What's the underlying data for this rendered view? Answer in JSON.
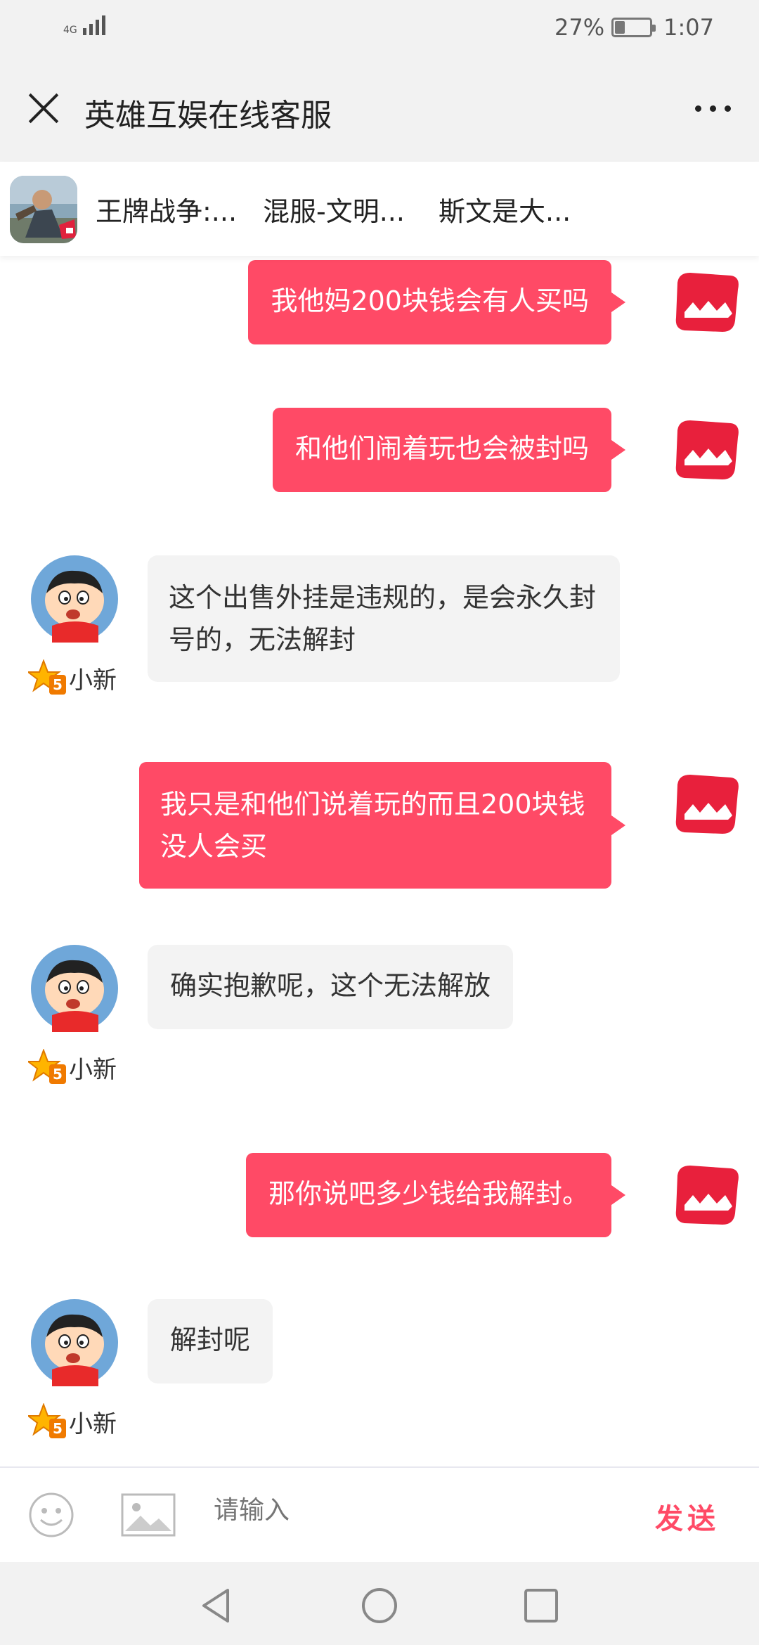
{
  "status": {
    "network": "4G",
    "battery": "27%",
    "battery_level": 0.27,
    "time": "1:07"
  },
  "header": {
    "title": "英雄互娱在线客服"
  },
  "games": [
    "王牌战争:...",
    "混服-文明...",
    "斯文是大..."
  ],
  "messages": [
    {
      "from": "user",
      "text": "我他妈200块钱会有人买吗"
    },
    {
      "from": "user",
      "text": "和他们闹着玩也会被封吗"
    },
    {
      "from": "agent",
      "text": "这个出售外挂是违规的，是会永久封号的，无法解封",
      "name": "小新",
      "badge": "5"
    },
    {
      "from": "user",
      "text": "我只是和他们说着玩的而且200块钱没人会买"
    },
    {
      "from": "agent",
      "text": "确实抱歉呢，这个无法解放",
      "name": "小新",
      "badge": "5"
    },
    {
      "from": "user",
      "text": "那你说吧多少钱给我解封。"
    },
    {
      "from": "agent",
      "text": "解封呢",
      "name": "小新",
      "badge": "5"
    }
  ],
  "input": {
    "placeholder": "请输入",
    "send_label": "发送"
  },
  "colors": {
    "accent": "#ff4a66",
    "bar_bg": "#f2f2f2",
    "agent_bubble": "#f3f3f3"
  }
}
